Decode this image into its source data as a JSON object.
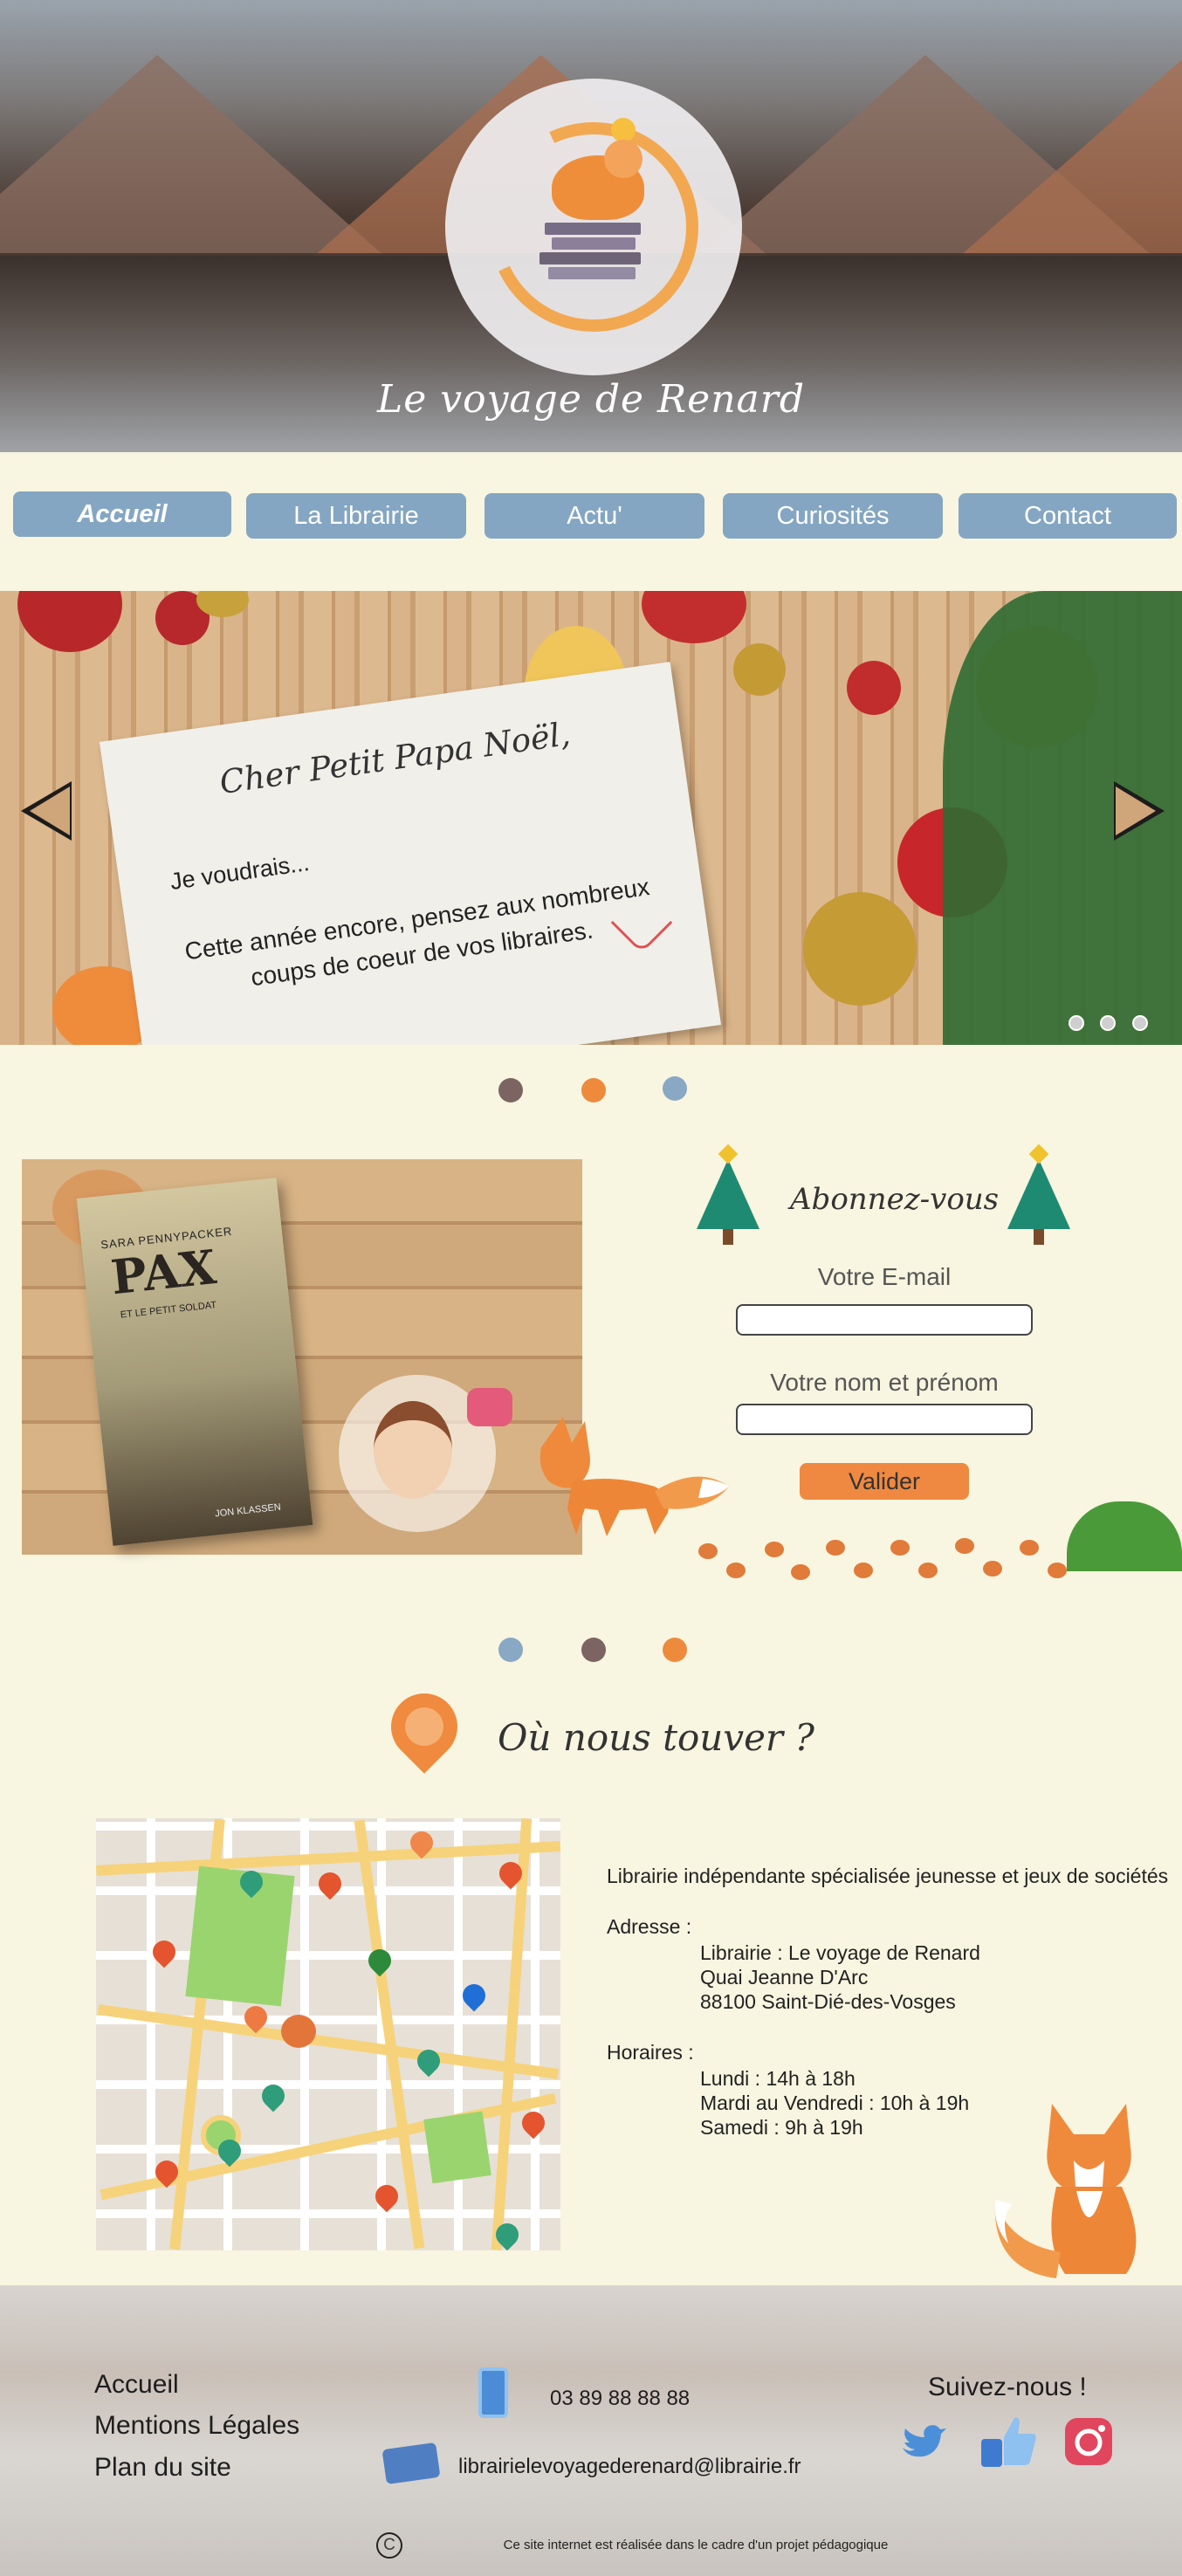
{
  "header": {
    "site_title": "Le voyage de Renard"
  },
  "nav": {
    "items": [
      {
        "label": "Accueil",
        "active": true
      },
      {
        "label": "La Librairie",
        "active": false
      },
      {
        "label": "Actu'",
        "active": false
      },
      {
        "label": "Curiosités",
        "active": false
      },
      {
        "label": "Contact",
        "active": false
      }
    ]
  },
  "slider": {
    "greeting": "Cher Petit Papa Noël,",
    "line1": "Je voudrais...",
    "line2": "Cette année encore, pensez aux nombreux coups de coeur de vos libraires."
  },
  "book": {
    "author": "SARA PENNYPACKER",
    "title": "PAX",
    "subtitle": "ET LE PETIT SOLDAT",
    "illustrator": "JON KLASSEN"
  },
  "newsletter": {
    "title": "Abonnez-vous",
    "email_label": "Votre E-mail",
    "email_value": "",
    "name_label": "Votre nom et prénom",
    "name_value": "",
    "submit": "Valider"
  },
  "location": {
    "title": "Où nous touver ?",
    "intro": "Librairie indépendante spécialisée jeunesse et jeux de sociétés",
    "address_label": "Adresse :",
    "address_lines": [
      "Librairie : Le voyage de Renard",
      "Quai Jeanne D'Arc",
      "88100 Saint-Dié-des-Vosges"
    ],
    "hours_label": "Horaires :",
    "hours_lines": [
      "Lundi : 14h à 18h",
      "Mardi au Vendredi : 10h à 19h",
      "Samedi : 9h à 19h"
    ]
  },
  "footer": {
    "links": [
      "Accueil",
      "Mentions Légales",
      "Plan du site"
    ],
    "phone": "03 89 88 88 88",
    "email": "librairielevoyagederenard@librairie.fr",
    "social_title": "Suivez-nous !",
    "credit": "Ce site internet est réalisée dans le cadre d'un projet pédagogique"
  },
  "colors": {
    "accent_blue": "#84a6c2",
    "accent_orange": "#ef8941",
    "dot_brown": "#7b6462",
    "background": "#f8f5e0"
  }
}
